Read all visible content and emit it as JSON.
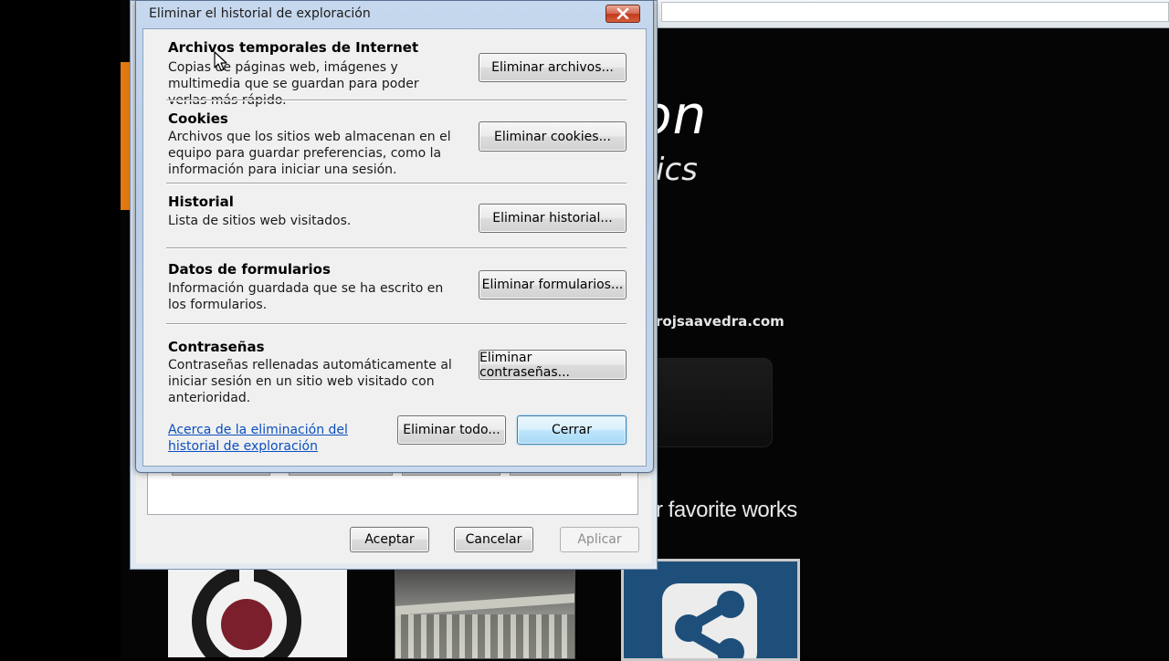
{
  "background": {
    "hero_word": "on",
    "hero_sub": "ics",
    "site_email": "rojsaavedra.com",
    "favorites_text": "r favorite works"
  },
  "options_window": {
    "buttons": {
      "accept": "Aceptar",
      "cancel": "Cancelar",
      "apply": "Aplicar"
    }
  },
  "dialog": {
    "title": "Eliminar el historial de exploración",
    "sections": [
      {
        "title": "Archivos temporales de Internet",
        "description": "Copias de páginas web, imágenes y multimedia que se guardan para poder verlas más rápido.",
        "button": "Eliminar archivos..."
      },
      {
        "title": "Cookies",
        "description": "Archivos que los sitios web almacenan en el equipo para guardar preferencias, como la información para iniciar una sesión.",
        "button": "Eliminar cookies..."
      },
      {
        "title": "Historial",
        "description": "Lista de sitios web visitados.",
        "button": "Eliminar historial..."
      },
      {
        "title": "Datos de formularios",
        "description": "Información guardada que se ha escrito en los formularios.",
        "button": "Eliminar formularios..."
      },
      {
        "title": "Contraseñas",
        "description": "Contraseñas rellenadas automáticamente al iniciar sesión en un sitio web visitado con anterioridad.",
        "button": "Eliminar contraseñas..."
      }
    ],
    "help_link": "Acerca de la eliminación del historial de exploración",
    "delete_all": "Eliminar todo...",
    "close": "Cerrar"
  },
  "colors": {
    "link": "#0b4fc2",
    "title_bar": "#c6d8ee",
    "close_button": "#c1391c",
    "accent_orange": "#e07a10"
  },
  "icons": {
    "close": "close-icon",
    "cursor": "mouse-cursor-icon"
  }
}
